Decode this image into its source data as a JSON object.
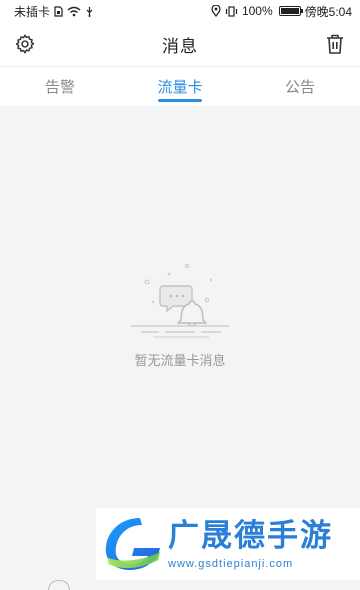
{
  "status_bar": {
    "carrier": "未插卡",
    "battery_percent": "100%",
    "battery_level": 1.0,
    "time": "傍晚5:04"
  },
  "header": {
    "title": "消息",
    "settings_icon": "gear-icon",
    "delete_icon": "trash-icon"
  },
  "tabs": [
    {
      "label": "告警",
      "active": false
    },
    {
      "label": "流量卡",
      "active": true
    },
    {
      "label": "公告",
      "active": false
    }
  ],
  "empty_state": {
    "icon": "empty-bell-chat-icon",
    "message": "暂无流量卡消息"
  },
  "watermark": {
    "title": "广晟德手游",
    "url": "www.gsdtiepianji.com"
  },
  "colors": {
    "accent": "#2a8ee0",
    "background": "#f4f4f4",
    "watermark": "#2a7fd6"
  }
}
